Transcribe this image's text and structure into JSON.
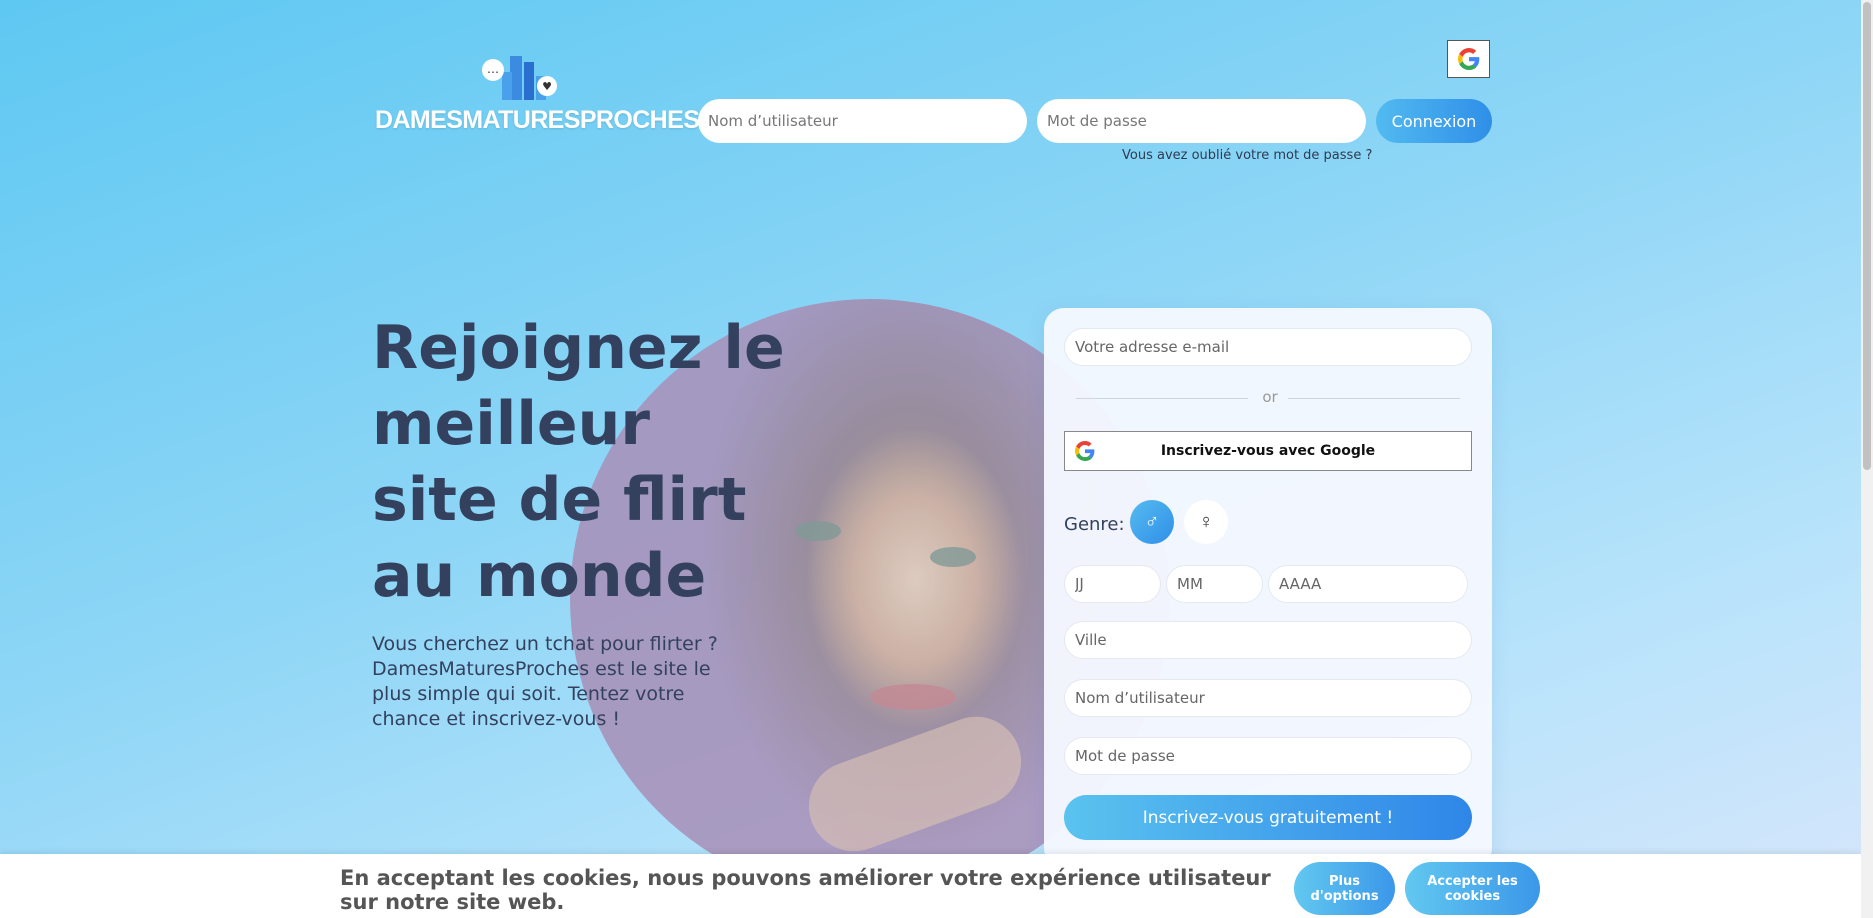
{
  "header": {
    "logo_text": "DAMESMATURESPROCHES",
    "username_placeholder": "Nom d’utilisateur",
    "password_placeholder": "Mot de passe",
    "login_label": "Connexion",
    "forgot_link": "Vous avez oublié votre mot de passe ?",
    "google_icon": "google-icon"
  },
  "hero": {
    "title": "Rejoignez le meilleur site de flirt au monde",
    "subtitle": "Vous cherchez un tchat pour flirter ? DamesMaturesProches est le site le plus simple qui soit. Tentez votre chance et inscrivez-vous !"
  },
  "signup": {
    "email_placeholder": "Votre adresse e-mail",
    "or_text": "or",
    "google_label": "Inscrivez-vous avec Google",
    "genre_label": "Genre:",
    "male_icon": "♂",
    "female_icon": "♀",
    "day_placeholder": "JJ",
    "month_placeholder": "MM",
    "year_placeholder": "AAAA",
    "city_placeholder": "Ville",
    "username_placeholder": "Nom d’utilisateur",
    "password_placeholder": "Mot de passe",
    "submit_label": "Inscrivez-vous gratuitement !"
  },
  "cookie": {
    "text": "En acceptant les cookies, nous pouvons améliorer votre expérience utilisateur sur notre site web.",
    "more_label": "Plus d'options",
    "accept_label": "Accepter les cookies"
  },
  "colors": {
    "accent": "#2f8fe8",
    "text_dark": "#33415e"
  }
}
